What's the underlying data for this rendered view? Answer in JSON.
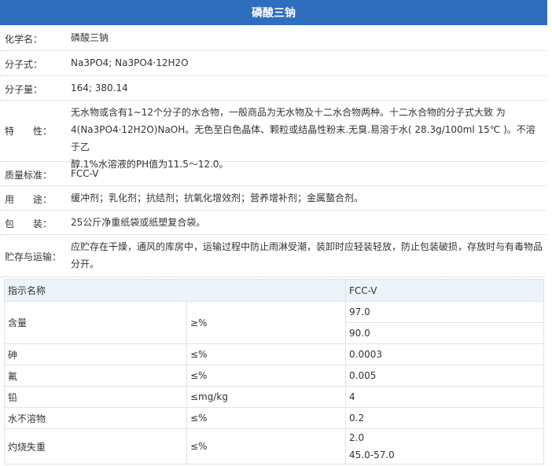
{
  "title": "磷酸三钠",
  "info": {
    "chemical_name": {
      "label": "化学名：",
      "value": "磷酸三钠"
    },
    "formula": {
      "label": "分子式：",
      "value": "Na3PO4; Na3PO4·12H2O"
    },
    "weight": {
      "label": "分子量：",
      "value": "164; 380.14"
    },
    "properties": {
      "label": "特　　性：",
      "line1": "无水物或含有1~12个分子的水合物，一般商品为无水物及十二水合物两种。十二水合物的分子式大致 为",
      "line2": "4(Na3PO4·12H2O)NaOH。无色至白色晶体、颗粒或结晶性粉末.无臭.易溶于水( 28.3g/100ml 15℃ )。不溶于乙",
      "line3": "醇.1%水溶液的PH值为11.5～12.0。"
    },
    "standard": {
      "label": "质量标准：",
      "value": "FCC-V"
    },
    "usage": {
      "label": "用　　途：",
      "value": "缓冲剂；乳化剂；抗结剂；抗氧化增效剂；营养增补剂；金属螯合剂。"
    },
    "packaging": {
      "label": "包　　装：",
      "value": "25公斤净重纸袋或纸塑复合袋。"
    },
    "storage": {
      "label": "贮存与运输：",
      "line1": "应贮存在干燥，通风的库房中，运输过程中防止雨淋受潮，装卸时应轻装轻放，防止包装破损，存放时与有毒物品",
      "line2": "分开。"
    }
  },
  "spec_table": {
    "header": {
      "name": "指示名称",
      "std": "FCC-V"
    },
    "rows": [
      {
        "name": "含量",
        "unit": "≥%",
        "values": [
          "97.0",
          "90.0"
        ]
      },
      {
        "name": "砷",
        "unit": "≤%",
        "value": "0.0003"
      },
      {
        "name": "氟",
        "unit": "≤%",
        "value": "0.005"
      },
      {
        "name": "铅",
        "unit": "≤mg/kg",
        "value": "4"
      },
      {
        "name": "水不溶物",
        "unit": "≤%",
        "value": "0.2"
      },
      {
        "name": "灼烧失重",
        "unit": "≤%",
        "values": [
          "2.0",
          "45.0-57.0"
        ]
      }
    ]
  }
}
